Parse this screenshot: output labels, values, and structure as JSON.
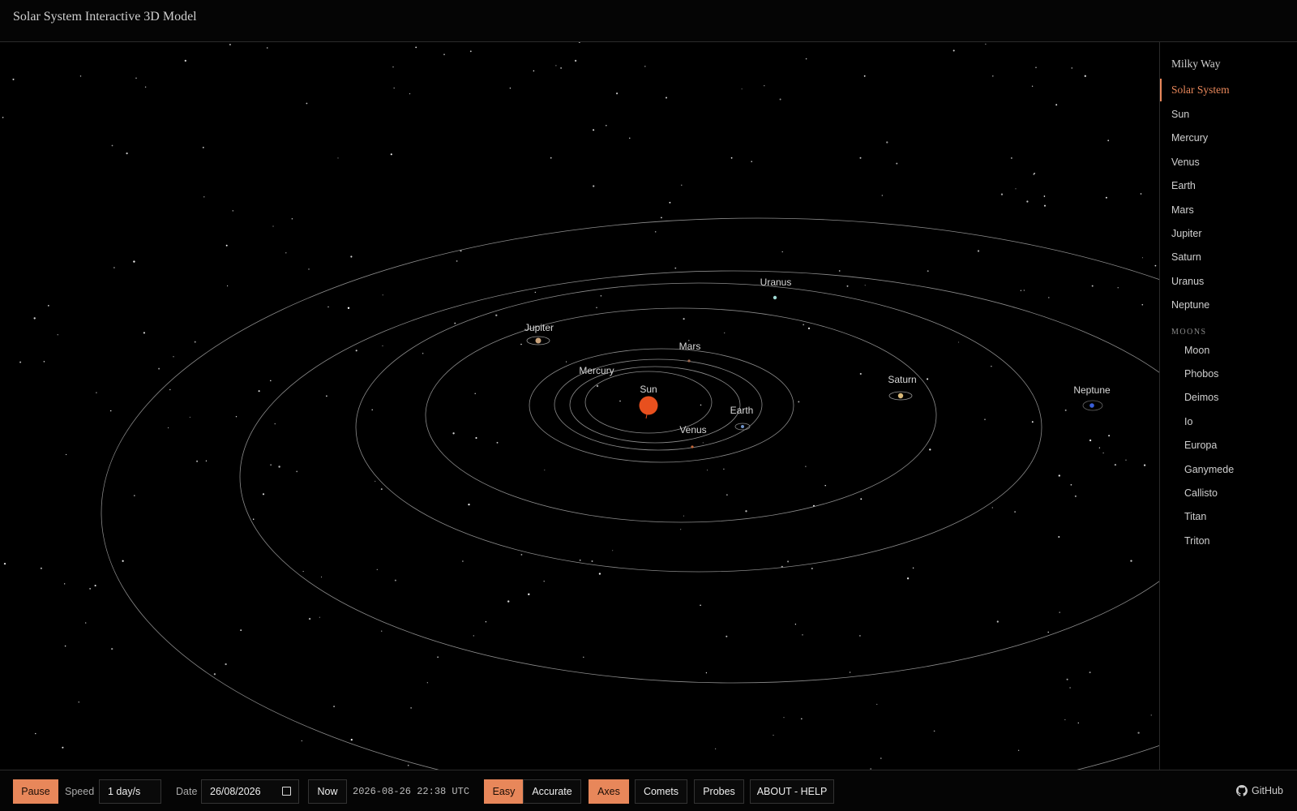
{
  "header": {
    "title": "Solar System Interactive 3D Model"
  },
  "scene": {
    "labels": {
      "sun": "Sun",
      "mercury": "Mercury",
      "venus": "Venus",
      "earth": "Earth",
      "mars": "Mars",
      "jupiter": "Jupiter",
      "saturn": "Saturn",
      "uranus": "Uranus",
      "neptune": "Neptune"
    },
    "colors": {
      "sun": "#e8501e",
      "orbit": "#8c8c8c",
      "accent": "#e8875a"
    }
  },
  "sidebar": {
    "top_items": [
      "Milky Way",
      "Solar System"
    ],
    "active_item": "Solar System",
    "bodies": [
      "Sun",
      "Mercury",
      "Venus",
      "Earth",
      "Mars",
      "Jupiter",
      "Saturn",
      "Uranus",
      "Neptune"
    ],
    "moons_heading": "MOONS",
    "moons": [
      "Moon",
      "Phobos",
      "Deimos",
      "Io",
      "Europa",
      "Ganymede",
      "Callisto",
      "Titan",
      "Triton"
    ]
  },
  "footer": {
    "pause_label": "Pause",
    "speed_label": "Speed",
    "speed_value": "1 day/s",
    "date_label": "Date",
    "date_value": "26/08/2026",
    "now_label": "Now",
    "datetime_readout": "2026-08-26 22:38 UTC",
    "easy_label": "Easy",
    "accurate_label": "Accurate",
    "axes_label": "Axes",
    "comets_label": "Comets",
    "probes_label": "Probes",
    "about_label": "ABOUT - HELP",
    "github_label": "GitHub",
    "mode_selected": "Easy",
    "axes_on": true
  }
}
